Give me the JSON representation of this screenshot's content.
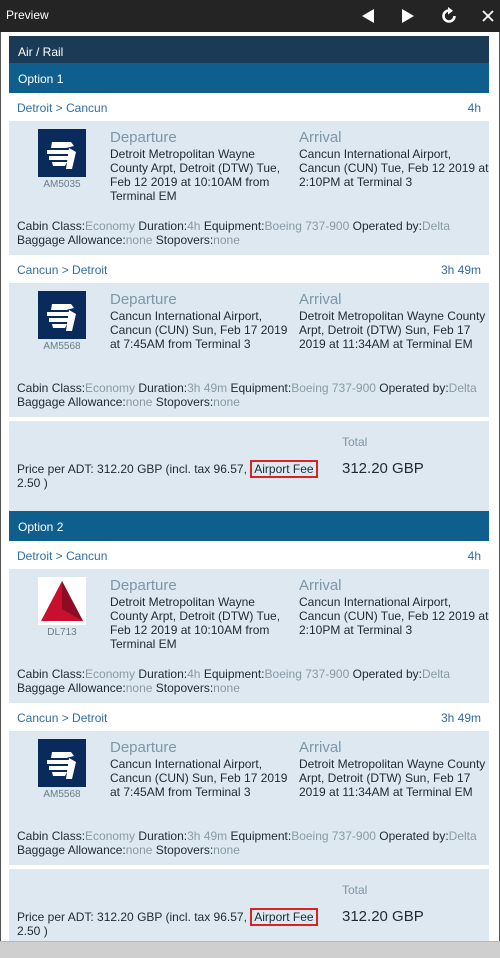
{
  "window": {
    "title": "Preview",
    "back_icon": "triangle-left-icon",
    "forward_icon": "triangle-right-icon",
    "refresh_icon": "refresh-icon",
    "close_icon": "close-icon"
  },
  "section_title": "Air / Rail",
  "options": [
    {
      "label": "Option 1",
      "legs": [
        {
          "route": "Detroit > Cancun",
          "duration": "4h",
          "airline_logo": "aeromexico-logo",
          "flight_no": "AM5035",
          "departure_label": "Departure",
          "departure_text": "Detroit Metropolitan Wayne County Arpt, Detroit (DTW) Tue, Feb 12 2019 at 10:10AM from Terminal EM",
          "arrival_label": "Arrival",
          "arrival_text": "Cancun International Airport, Cancun (CUN) Tue, Feb 12 2019 at 2:10PM at Terminal 3",
          "cabin_class_label": "Cabin Class:",
          "cabin_class": "Economy",
          "duration_label": "Duration:",
          "duration_val": "4h",
          "equipment_label": "Equipment:",
          "equipment": "Boeing 737-900",
          "operated_label": "Operated by:",
          "operated_by": "Delta",
          "baggage_label": "Baggage Allowance:",
          "baggage": "none",
          "stopovers_label": "Stopovers:",
          "stopovers": "none"
        },
        {
          "route": "Cancun > Detroit",
          "duration": "3h 49m",
          "airline_logo": "aeromexico-logo",
          "flight_no": "AM5568",
          "departure_label": "Departure",
          "departure_text": "Cancun International Airport, Cancun (CUN) Sun, Feb 17 2019 at 7:45AM from Terminal 3",
          "arrival_label": "Arrival",
          "arrival_text": "Detroit Metropolitan Wayne County Arpt, Detroit (DTW) Sun, Feb 17 2019 at 11:34AM at Terminal EM",
          "cabin_class_label": "Cabin Class:",
          "cabin_class": "Economy",
          "duration_label": "Duration:",
          "duration_val": "3h 49m",
          "equipment_label": "Equipment:",
          "equipment": "Boeing 737-900",
          "operated_label": "Operated by:",
          "operated_by": "Delta",
          "baggage_label": "Baggage Allowance:",
          "baggage": "none",
          "stopovers_label": "Stopovers:",
          "stopovers": "none"
        }
      ],
      "price": {
        "total_label": "Total",
        "text_before": "Price per ADT: 312.20 GBP (incl. tax 96.57, ",
        "fee_label": "Airport Fee",
        "text_after": " 2.50 )",
        "total_value": "312.20 GBP"
      }
    },
    {
      "label": "Option 2",
      "legs": [
        {
          "route": "Detroit > Cancun",
          "duration": "4h",
          "airline_logo": "delta-logo",
          "flight_no": "DL713",
          "departure_label": "Departure",
          "departure_text": "Detroit Metropolitan Wayne County Arpt, Detroit (DTW) Tue, Feb 12 2019 at 10:10AM from Terminal EM",
          "arrival_label": "Arrival",
          "arrival_text": "Cancun International Airport, Cancun (CUN) Tue, Feb 12 2019 at 2:10PM at Terminal 3",
          "cabin_class_label": "Cabin Class:",
          "cabin_class": "Economy",
          "duration_label": "Duration:",
          "duration_val": "4h",
          "equipment_label": "Equipment:",
          "equipment": "Boeing 737-900",
          "operated_label": "Operated by:",
          "operated_by": "Delta",
          "baggage_label": "Baggage Allowance:",
          "baggage": "none",
          "stopovers_label": "Stopovers:",
          "stopovers": "none"
        },
        {
          "route": "Cancun > Detroit",
          "duration": "3h 49m",
          "airline_logo": "aeromexico-logo",
          "flight_no": "AM5568",
          "departure_label": "Departure",
          "departure_text": "Cancun International Airport, Cancun (CUN) Sun, Feb 17 2019 at 7:45AM from Terminal 3",
          "arrival_label": "Arrival",
          "arrival_text": "Detroit Metropolitan Wayne County Arpt, Detroit (DTW) Sun, Feb 17 2019 at 11:34AM at Terminal EM",
          "cabin_class_label": "Cabin Class:",
          "cabin_class": "Economy",
          "duration_label": "Duration:",
          "duration_val": "3h 49m",
          "equipment_label": "Equipment:",
          "equipment": "Boeing 737-900",
          "operated_label": "Operated by:",
          "operated_by": "Delta",
          "baggage_label": "Baggage Allowance:",
          "baggage": "none",
          "stopovers_label": "Stopovers:",
          "stopovers": "none"
        }
      ],
      "price": {
        "total_label": "Total",
        "text_before": "Price per ADT: 312.20 GBP (incl. tax 96.57, ",
        "fee_label": "Airport Fee",
        "text_after": " 2.50 )",
        "total_value": "312.20 GBP"
      }
    }
  ],
  "colors": {
    "titlebar": "#242424",
    "section_header": "#1b3a55",
    "option_header": "#0e5f8e",
    "card_bg": "#dde8f0",
    "link_blue": "#2f6ea5",
    "highlight_border": "#d42424",
    "aeromexico_blue": "#0b2a5c",
    "delta_red": "#c8102e"
  }
}
